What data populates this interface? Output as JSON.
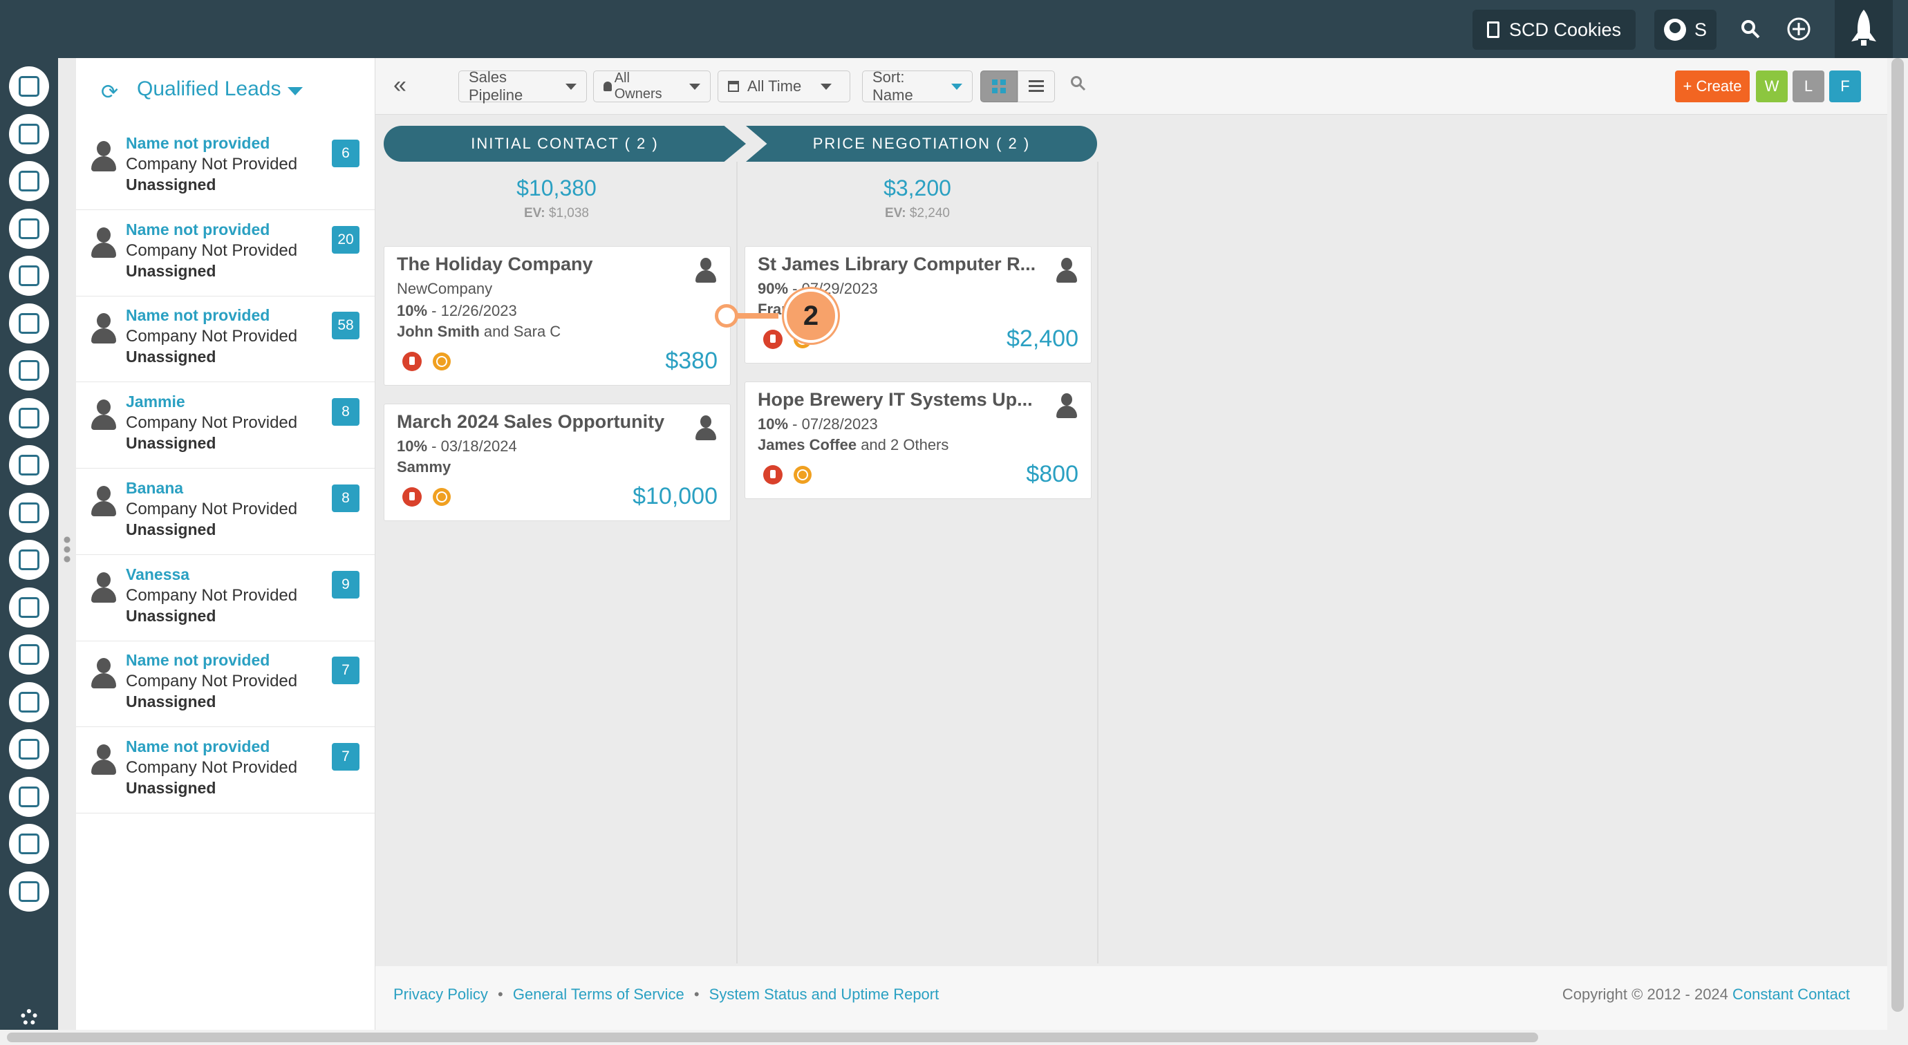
{
  "topbar": {
    "company_label": "SCD Cookies",
    "user_initial": "S",
    "search_icon": "search-icon",
    "add_icon": "plus-icon",
    "launch_icon": "rocket-icon"
  },
  "rail": {
    "icons": [
      "contacts-icon",
      "email-icon",
      "tasks-icon",
      "map-icon",
      "workflow-icon",
      "list-icon",
      "megaphone-icon",
      "chat-icon",
      "thumbs-up-icon",
      "tv-icon",
      "media-icon",
      "calendar-icon",
      "handshake-icon",
      "growth-chart-icon",
      "support-icon",
      "user-star-icon",
      "reports-icon",
      "plugin-icon"
    ],
    "settings_icon": "gear-icon"
  },
  "leads": {
    "title": "Qualified Leads",
    "items": [
      {
        "name": "Name not provided",
        "company": "Company Not Provided",
        "owner": "Unassigned",
        "count": "6"
      },
      {
        "name": "Name not provided",
        "company": "Company Not Provided",
        "owner": "Unassigned",
        "count": "20"
      },
      {
        "name": "Name not provided",
        "company": "Company Not Provided",
        "owner": "Unassigned",
        "count": "58"
      },
      {
        "name": "Jammie",
        "company": "Company Not Provided",
        "owner": "Unassigned",
        "count": "8"
      },
      {
        "name": "Banana",
        "company": "Company Not Provided",
        "owner": "Unassigned",
        "count": "8"
      },
      {
        "name": "Vanessa",
        "company": "Company Not Provided",
        "owner": "Unassigned",
        "count": "9"
      },
      {
        "name": "Name not provided",
        "company": "Company Not Provided",
        "owner": "Unassigned",
        "count": "7"
      },
      {
        "name": "Name not provided",
        "company": "Company Not Provided",
        "owner": "Unassigned",
        "count": "7"
      }
    ]
  },
  "toolbar": {
    "pipeline": "Sales Pipeline",
    "owners": "All Owners",
    "time": "All Time",
    "sort": "Sort: Name",
    "create": "+ Create",
    "w": "W",
    "l": "L",
    "f": "F",
    "colors": {
      "create": "#f26522",
      "w": "#8cc63f",
      "l": "#999999",
      "f": "#2aa0c2"
    }
  },
  "stages": [
    {
      "label": "INITIAL CONTACT ( 2 )",
      "total": "$10,380",
      "ev_label": "EV:",
      "ev_value": "$1,038",
      "cards": [
        {
          "title": "The Holiday Company",
          "company": "NewCompany",
          "pct": "10%",
          "date": " - 12/26/2023",
          "contact_bold": "John Smith",
          "contact_rest": " and Sara C",
          "amount": "$380"
        },
        {
          "title": "March 2024 Sales Opportunity",
          "pct": "10%",
          "date": " - 03/18/2024",
          "contact_bold": "Sammy",
          "contact_rest": "",
          "amount": "$10,000"
        }
      ]
    },
    {
      "label": "PRICE NEGOTIATION ( 2 )",
      "total": "$3,200",
      "ev_label": "EV:",
      "ev_value": "$2,240",
      "cards": [
        {
          "title": "St James Library Computer R...",
          "pct": "90%",
          "date": " - 07/29/2023",
          "contact_bold": "Fran",
          "contact_rest": "",
          "amount": "$2,400"
        },
        {
          "title": "Hope Brewery IT Systems Up...",
          "pct": "10%",
          "date": " - 07/28/2023",
          "contact_bold": "James Coffee",
          "contact_rest": " and 2 Others",
          "amount": "$800"
        }
      ]
    }
  ],
  "marker": {
    "number": "2"
  },
  "footer": {
    "privacy": "Privacy Policy",
    "terms": "General Terms of Service",
    "status": "System Status and Uptime Report",
    "sep": "•",
    "copyright": "Copyright © 2012 - 2024 ",
    "brand": "Constant Contact"
  }
}
